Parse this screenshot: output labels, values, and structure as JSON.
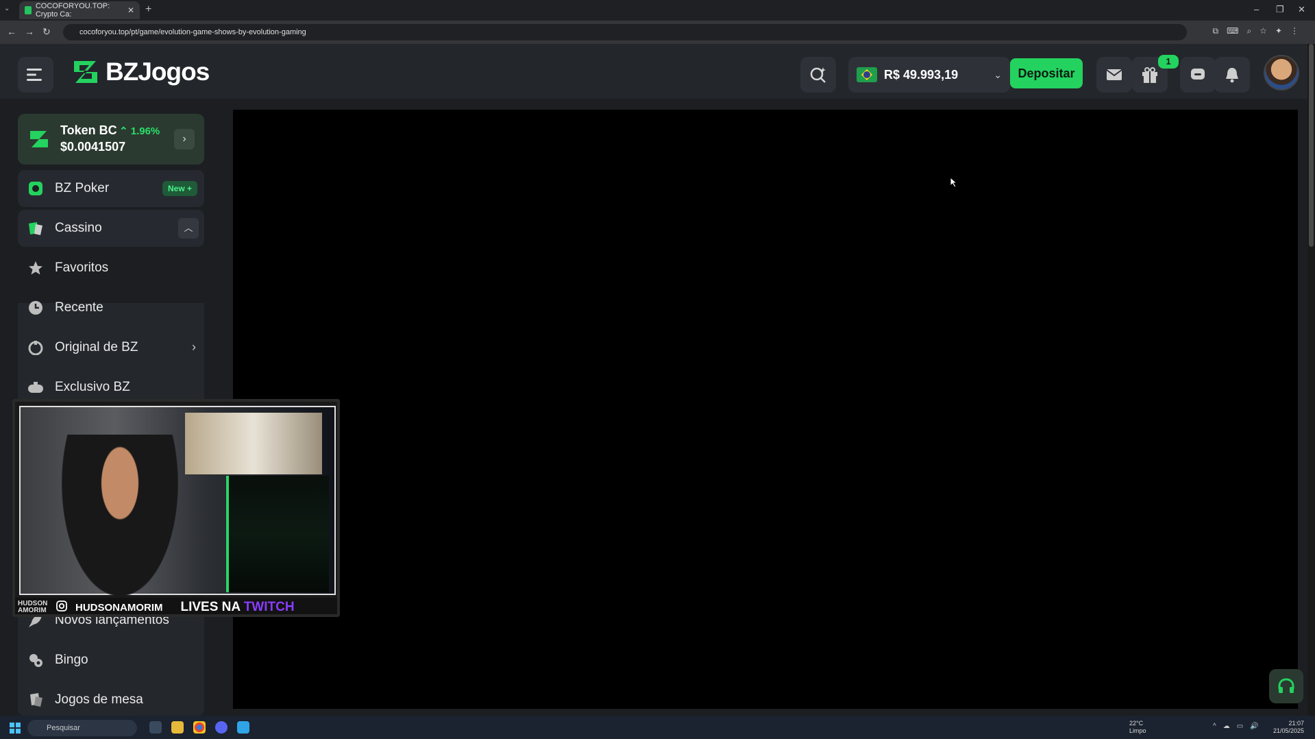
{
  "browser": {
    "tab_title": "COCOFORYOU.TOP: Crypto Ca:",
    "tab_close": "✕",
    "new_tab": "+",
    "url": "cocoforyou.top/pt/game/evolution-game-shows-by-evolution-gaming"
  },
  "header": {
    "logo_text": "BZJogos",
    "balance": "R$ 49.993,19",
    "deposit_label": "Depositar",
    "gift_badge": "1"
  },
  "token": {
    "name": "Token BC",
    "change": "⌃ 1.96%",
    "price": "$0.0041507"
  },
  "sidebar": {
    "items": [
      {
        "label": "BZ Poker",
        "badge": "New +"
      },
      {
        "label": "Cassino"
      },
      {
        "label": "Favoritos"
      },
      {
        "label": "Recente"
      },
      {
        "label": "Original de BZ"
      },
      {
        "label": "Exclusivo BZ"
      },
      {
        "label": "Novos lançamentos"
      },
      {
        "label": "Bingo"
      },
      {
        "label": "Jogos de mesa"
      }
    ]
  },
  "cam": {
    "brand": "HUDSON AMORIM",
    "handle": "HUDSONAMORIM",
    "lives_prefix": "LIVES NA ",
    "lives_platform": "TWITCH"
  },
  "taskbar": {
    "search_placeholder": "Pesquisar",
    "temperature": "22°C",
    "weather": "Limpo",
    "time": "21:07",
    "date": "21/05/2025"
  },
  "colors": {
    "accent_green": "#24d25f",
    "background": "#1c1e22",
    "header": "#23262b",
    "twitch_purple": "#8a3cff"
  }
}
